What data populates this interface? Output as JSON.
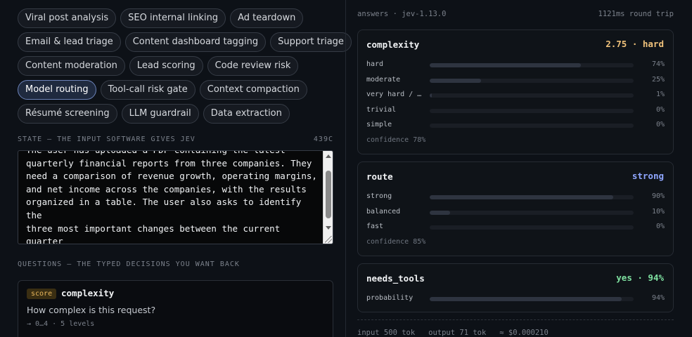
{
  "chips": [
    [
      {
        "label": "Viral post analysis"
      },
      {
        "label": "SEO internal linking"
      },
      {
        "label": "Ad teardown"
      }
    ],
    [
      {
        "label": "Email & lead triage"
      },
      {
        "label": "Content dashboard tagging"
      },
      {
        "label": "Support triage"
      }
    ],
    [
      {
        "label": "Content moderation"
      },
      {
        "label": "Lead scoring"
      },
      {
        "label": "Code review risk"
      }
    ],
    [
      {
        "label": "Model routing",
        "active": true
      },
      {
        "label": "Tool-call risk gate"
      },
      {
        "label": "Context compaction"
      }
    ],
    [
      {
        "label": "Résumé screening"
      },
      {
        "label": "LLM guardrail"
      },
      {
        "label": "Data extraction"
      }
    ]
  ],
  "state": {
    "heading": "STATE — THE INPUT SOFTWARE GIVES JEV",
    "char_count": "439C",
    "text": "The user has uploaded a PDF containing the latest\nquarterly financial reports from three companies. They\nneed a comparison of revenue growth, operating margins,\nand net income across the companies, with the results\norganized in a table. The user also asks to identify the\nthree most important changes between the current quarter\nand the previous quarter and explain what may have caused\nthem based only on information contained in the PDF."
  },
  "questions": {
    "heading": "QUESTIONS — THE TYPED DECISIONS YOU WANT BACK",
    "items": [
      {
        "badge": "score",
        "name": "complexity",
        "prompt": "How complex is this request?",
        "meta": "→ 0…4 · 5 levels"
      }
    ]
  },
  "answers": {
    "heading": "answers · jev-1.13.0",
    "round_trip": "1121ms round trip",
    "cards": [
      {
        "title": "complexity",
        "result": "2.75 · hard",
        "result_color": "#f0c27b",
        "options": [
          {
            "label": "hard",
            "pct": "74%",
            "value": 0.74
          },
          {
            "label": "moderate",
            "pct": "25%",
            "value": 0.25
          },
          {
            "label": "very hard / …",
            "pct": "1%",
            "value": 0.01
          },
          {
            "label": "trivial",
            "pct": "0%",
            "value": 0
          },
          {
            "label": "simple",
            "pct": "0%",
            "value": 0
          }
        ],
        "confidence": "confidence 78%"
      },
      {
        "title": "route",
        "result": "strong",
        "result_color": "#8fa6ff",
        "options": [
          {
            "label": "strong",
            "pct": "90%",
            "value": 0.9
          },
          {
            "label": "balanced",
            "pct": "10%",
            "value": 0.1
          },
          {
            "label": "fast",
            "pct": "0%",
            "value": 0
          }
        ],
        "confidence": "confidence 85%"
      },
      {
        "title": "needs_tools",
        "result": "yes · 94%",
        "result_color": "#7ee0a0",
        "options": [
          {
            "label": "probability",
            "pct": "94%",
            "value": 0.94
          }
        ],
        "confidence": ""
      }
    ],
    "usage": "input 500 tok   output 71 tok   ≈ $0.000210"
  }
}
